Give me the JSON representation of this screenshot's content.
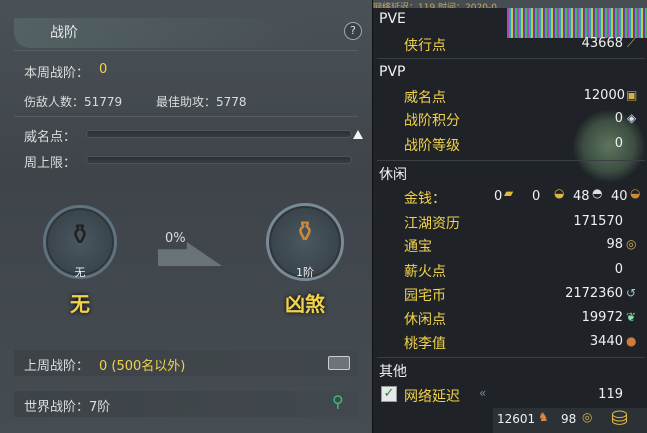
{
  "left": {
    "title": "战阶",
    "help": "?",
    "weekly_rank_label": "本周战阶：",
    "weekly_rank_value": "0",
    "kills": "伤敌人数：51779",
    "best_assist": "最佳助攻：5778",
    "prestige_label": "威名点：",
    "weekly_cap_label": "周上限：",
    "current_badge": {
      "small": "无",
      "big": "无"
    },
    "progress_percent": "0%",
    "next_badge": {
      "small": "1阶",
      "big": "凶煞"
    },
    "last_week_label": "上周战阶：",
    "last_week_value": "0 (500名以外)",
    "world_rank": "世界战阶：7阶"
  },
  "right": {
    "top_text": "网络延迟：119  时间：2020-0",
    "pve": {
      "header": "PVE",
      "rows": [
        {
          "label": "侠行点",
          "value": "43668",
          "icon": "sword-icon"
        }
      ]
    },
    "pvp": {
      "header": "PVP",
      "rows": [
        {
          "label": "威名点",
          "value": "12000",
          "icon": "prestige-icon"
        },
        {
          "label": "战阶积分",
          "value": "0",
          "icon": "crystal-icon"
        },
        {
          "label": "战阶等级",
          "value": "0"
        }
      ]
    },
    "leisure": {
      "header": "休闲",
      "money_label": "金钱：",
      "money_values": [
        "0",
        "0",
        "48",
        "40"
      ],
      "rows": [
        {
          "label": "江湖资历",
          "value": "171570"
        },
        {
          "label": "通宝",
          "value": "98",
          "icon": "coin-icon"
        },
        {
          "label": "薪火点",
          "value": "0"
        },
        {
          "label": "园宅币",
          "value": "2172360",
          "icon": "house-coin-icon"
        },
        {
          "label": "休闲点",
          "value": "19972",
          "icon": "leaf-icon"
        },
        {
          "label": "桃李值",
          "value": "3440",
          "icon": "gourd-icon"
        }
      ]
    },
    "other": {
      "header": "其他",
      "latency_label": "网络延迟",
      "latency_value": "119",
      "checked": "✓"
    },
    "bottom": {
      "value_a": "12601",
      "value_b": "98"
    }
  }
}
